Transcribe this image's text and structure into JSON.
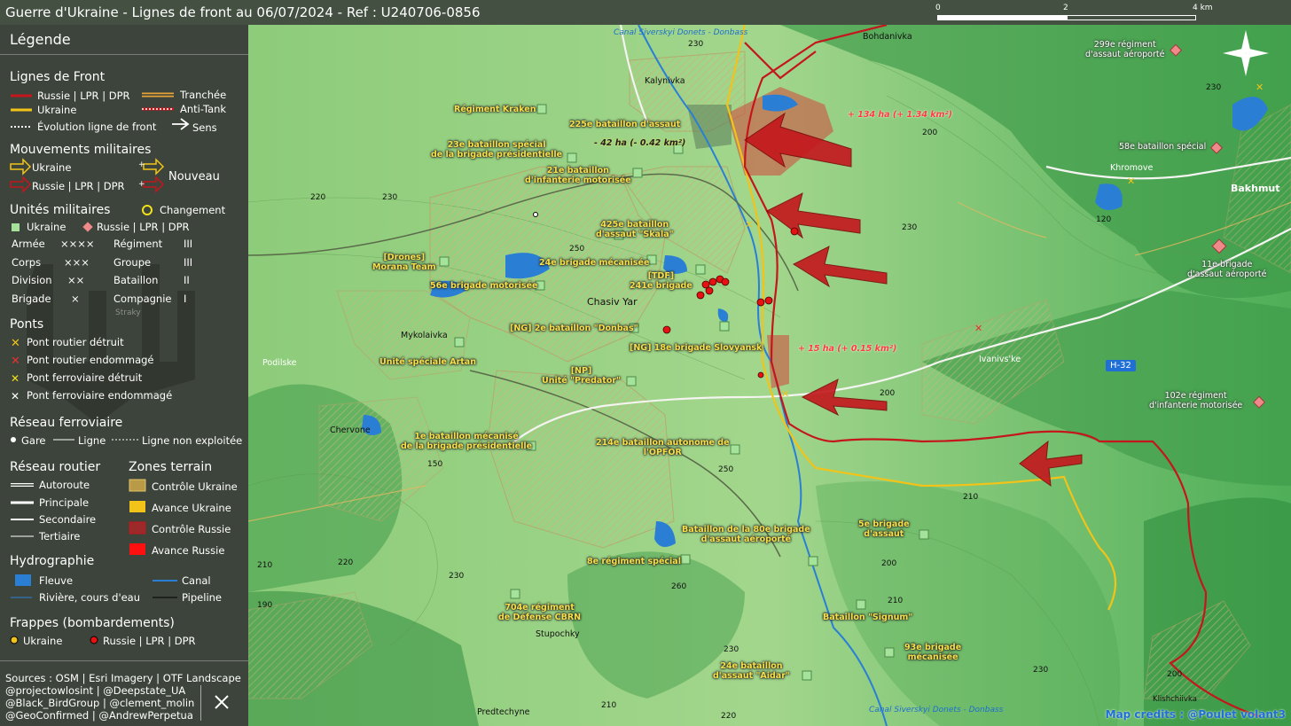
{
  "header": {
    "title": "Guerre d'Ukraine - Lignes de front au 06/07/2024 - Ref : U240706-0856",
    "scale": {
      "labels": [
        "0",
        "2",
        "4 km"
      ]
    }
  },
  "compass": {
    "label": "N"
  },
  "legend": {
    "title": "Légende",
    "front": {
      "title": "Lignes de Front",
      "items": [
        "Russie | LPR | DPR",
        "Ukraine",
        "Évolution ligne de front",
        "Tranchée",
        "Anti-Tank",
        "Sens"
      ]
    },
    "movements": {
      "title": "Mouvements militaires",
      "ukraine": "Ukraine",
      "russia": "Russie | LPR | DPR",
      "new": "Nouveau"
    },
    "units": {
      "title": "Unités militaires",
      "change": "Changement",
      "ukraine": "Ukraine",
      "russia": "Russie | LPR | DPR",
      "rows": [
        {
          "a": "Armée",
          "b": "××××",
          "c": "Régiment",
          "d": "III"
        },
        {
          "a": "Corps",
          "b": "×××",
          "c": "Groupe",
          "d": "III"
        },
        {
          "a": "Division",
          "b": "××",
          "c": "Bataillon",
          "d": "II"
        },
        {
          "a": "Brigade",
          "b": "×",
          "c": "Compagnie",
          "d": "I"
        }
      ]
    },
    "bridges": {
      "title": "Ponts",
      "items": [
        "Pont routier détruit",
        "Pont routier endommagé",
        "Pont ferroviaire détruit",
        "Pont ferroviaire endommagé"
      ]
    },
    "rail": {
      "title": "Réseau ferroviaire",
      "station": "Gare",
      "line": "Ligne",
      "unused": "Ligne non exploitée"
    },
    "roads": {
      "title": "Réseau routier",
      "items": [
        "Autoroute",
        "Principale",
        "Secondaire",
        "Tertiaire"
      ]
    },
    "zones": {
      "title": "Zones terrain",
      "items": [
        "Contrôle Ukraine",
        "Avance Ukraine",
        "Contrôle Russie",
        "Avance Russie"
      ]
    },
    "hydro": {
      "title": "Hydrographie",
      "river": "Fleuve",
      "canal": "Canal",
      "stream": "Rivière, cours d'eau",
      "pipeline": "Pipeline"
    },
    "strikes": {
      "title": "Frappes (bombardements)",
      "ukraine": "Ukraine",
      "russia": "Russie | LPR | DPR"
    },
    "sources": [
      "Sources : OSM | Esri Imagery | OTF Landscape",
      "@projectowlosint | @Deepstate_UA",
      "@Black_BirdGroup | @clement_molin",
      "@GeoConfirmed | @AndrewPerpetua"
    ],
    "x_icon": "x-logo-icon",
    "watermark": "Straky"
  },
  "colors": {
    "russia": "#c4161c",
    "ukraine": "#f2c318",
    "unit_ua": "#a6e39a",
    "unit_ru": "#f08a8a",
    "water": "#2a7fd4",
    "label_yellow": "#f6e04a"
  },
  "map": {
    "towns": [
      "Bohdanivka",
      "Kalynivka",
      "Khromove",
      "Bakhmut",
      "Chasiv Yar",
      "Mykolaivka",
      "Podilske",
      "Chervone",
      "Ivanivs'ke",
      "Stupochky",
      "Predtechyne",
      "Klishchiivka"
    ],
    "canal_top": "Canal Siverskyi Donets - Donbass",
    "canal_bottom": "Canal Siverskyi Donets - Donbass",
    "road_tag": "H-32",
    "changes": {
      "a": "+ 134 ha (+ 1.34 km²)",
      "b": "- 42 ha (- 0.42 km²)",
      "c": "+ 15 ha (+ 0.15 km²)"
    },
    "elevations": [
      "230",
      "200",
      "230",
      "220",
      "230",
      "250",
      "230",
      "120",
      "200",
      "200",
      "150",
      "250",
      "210",
      "210",
      "200",
      "220",
      "230",
      "260",
      "230",
      "210",
      "230",
      "220",
      "210",
      "190"
    ],
    "units_ua": [
      "Régiment Kraken",
      "225e bataillon d'assaut",
      "23e bataillon spécial\nde la brigade présidentielle",
      "21e bataillon\nd'infanterie motorisée",
      "425e bataillon\nd'assaut \"Skala\"",
      "[Drones]\nMorana Team",
      "24e brigade mécanisée",
      "[TDF]\n241e brigade",
      "56e brigade motorisée",
      "[NG] 2e bataillon \"Donbas\"",
      "[NG] 18e brigade Slovyansk",
      "Unité spéciale Artan",
      "[NP]\nUnité \"Predator\"",
      "1e bataillon mécanisé\nde la brigade présidentielle",
      "214e bataillon autonome de\nl'OPFOR",
      "Bataillon de la 80e brigade\nd'assaut aéroporté",
      "5e brigade\nd'assaut",
      "8e régiment spécial",
      "704e régiment\nde Défense CBRN",
      "Bataillon \"Signum\"",
      "93e brigade\nmécanisée",
      "24e bataillon\nd'assaut \"Aidar\""
    ],
    "units_ru": [
      "299e régiment\nd'assaut aéroporté",
      "58e bataillon spécial",
      "11e brigade\nd'assaut aéroporté",
      "102e régiment\nd'infanterie motorisée"
    ],
    "credits": "Map credits : @Poulet volant3"
  }
}
